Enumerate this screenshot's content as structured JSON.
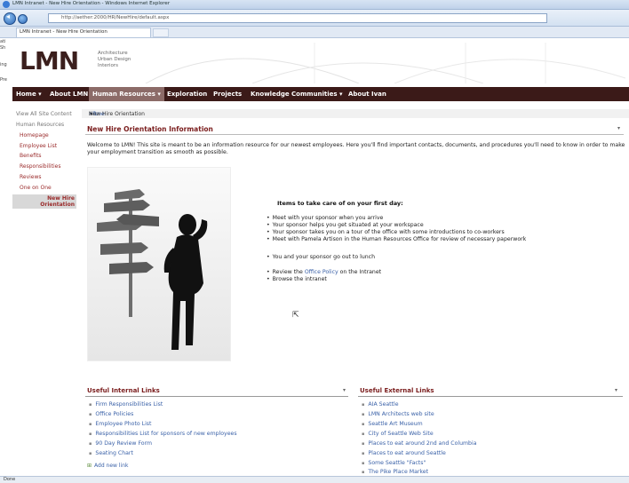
{
  "browser": {
    "title": "LMN Intranet - New Hire Orientation - Windows Internet Explorer",
    "address": "http://aether:2000/HR/NewHire/default.aspx",
    "tab_label": "LMN Intranet - New Hire Orientation",
    "status": "Done",
    "left_clip": [
      "ati",
      "Sh",
      "ing",
      "Pre"
    ]
  },
  "header": {
    "logo": "LMN",
    "logo_sub": [
      "Architecture",
      "Urban Design",
      "Interiors"
    ]
  },
  "topnav": {
    "home": "Home ▾",
    "about_lmn": "About LMN",
    "human_resources": "Human Resources ▾",
    "exploration": "Exploration",
    "projects": "Projects",
    "knowledge": "Knowledge Communities ▾",
    "about_ivan": "About Ivan"
  },
  "leftnav": {
    "view_all": "View All Site Content",
    "section": "Human Resources",
    "items": [
      "Homepage",
      "Employee List",
      "Benefits",
      "Responsibilities",
      "Reviews",
      "One on One"
    ],
    "selected": "New Hire Orientation"
  },
  "breadcrumb": {
    "home": "Home",
    "sep1": " > ",
    "hr": "HR",
    "sep2": " > ",
    "current": "New Hire Orientation"
  },
  "main": {
    "title": "New Hire Orientation Information",
    "intro": "Welcome to LMN!  This site is meant to be an information resource for our newest employees.  Here you'll find important contacts, documents, and procedures you'll need to know in order to make your employment transition as smooth as possible.",
    "tasks_title": "Items to take care of on your first day:",
    "tasks": [
      "Meet with your sponsor when you arrive",
      "Your sponsor helps you get situated at your workspace",
      "Your sponsor takes you on a tour of the office with some introductions to co-workers",
      "Meet with Pamela Artison in the Human Resources Office for review of necessary paperwork",
      "You and your sponsor go out to lunch"
    ],
    "review_prefix": "Review the ",
    "review_link": "Office Policy",
    "review_suffix": " on the Intranet",
    "browse": "Browse the intranet"
  },
  "internal_links": {
    "title": "Useful Internal Links",
    "items": [
      "Firm Responsibilities List",
      "Office Policies",
      "Employee Photo List",
      "Responsibilities List for sponsors of new employees",
      "90 Day Review Form",
      "Seating Chart"
    ],
    "add_new": "Add new link"
  },
  "external_links": {
    "title": "Useful External Links",
    "items": [
      "AIA Seattle",
      "LMN Architects web site",
      "Seattle Art Museum",
      "City of Seattle Web Site",
      "Places to eat around 2nd and Columbia",
      "Places to eat around Seattle",
      "Some Seattle \"Facts\"",
      "The Pike Place Market"
    ]
  },
  "colors": {
    "nav_bg": "#3b1a18",
    "nav_active": "#8c6b68",
    "title_red": "#7a1d1d",
    "link_blue": "#3b62a8"
  }
}
